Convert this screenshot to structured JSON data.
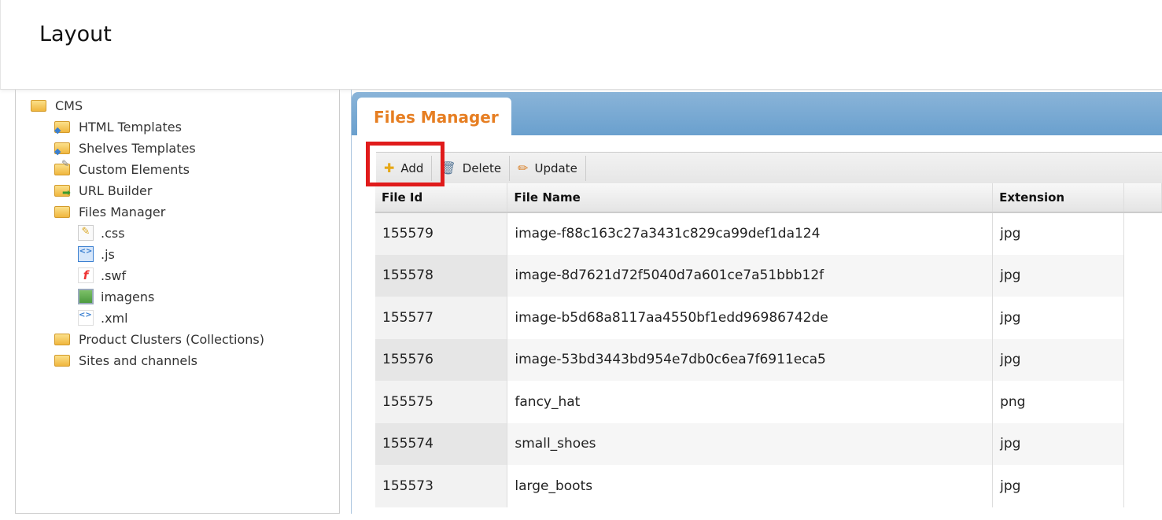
{
  "header": {
    "title": "Layout"
  },
  "tree": {
    "root": {
      "label": "CMS",
      "icon": "folder-open-icon"
    },
    "items": [
      {
        "label": "HTML Templates",
        "icon": "folder-code-icon"
      },
      {
        "label": "Shelves Templates",
        "icon": "folder-code-icon"
      },
      {
        "label": "Custom Elements",
        "icon": "folder-tools-icon"
      },
      {
        "label": "URL Builder",
        "icon": "folder-arrow-icon"
      },
      {
        "label": "Files Manager",
        "icon": "folder-open-icon"
      }
    ],
    "files": [
      {
        "label": ".css",
        "icon": "css-file-icon"
      },
      {
        "label": ".js",
        "icon": "js-file-icon"
      },
      {
        "label": ".swf",
        "icon": "flash-file-icon"
      },
      {
        "label": "imagens",
        "icon": "image-file-icon"
      },
      {
        "label": ".xml",
        "icon": "xml-file-icon"
      }
    ],
    "bottom": [
      {
        "label": "Product Clusters (Collections)",
        "icon": "folder-icon"
      },
      {
        "label": "Sites and channels",
        "icon": "folder-icon"
      }
    ]
  },
  "panel": {
    "tab": "Files Manager",
    "accent": "#e67e22"
  },
  "toolbar": {
    "add": "Add",
    "delete": "Delete",
    "update": "Update"
  },
  "table": {
    "columns": [
      "File Id",
      "File Name",
      "Extension"
    ],
    "rows": [
      [
        "155579",
        "image-f88c163c27a3431c829ca99def1da124",
        "jpg"
      ],
      [
        "155578",
        "image-8d7621d72f5040d7a601ce7a51bbb12f",
        "jpg"
      ],
      [
        "155577",
        "image-b5d68a8117aa4550bf1edd96986742de",
        "jpg"
      ],
      [
        "155576",
        "image-53bd3443bd954e7db0c6ea7f6911eca5",
        "jpg"
      ],
      [
        "155575",
        "fancy_hat",
        "png"
      ],
      [
        "155574",
        "small_shoes",
        "jpg"
      ],
      [
        "155573",
        "large_boots",
        "jpg"
      ]
    ]
  }
}
